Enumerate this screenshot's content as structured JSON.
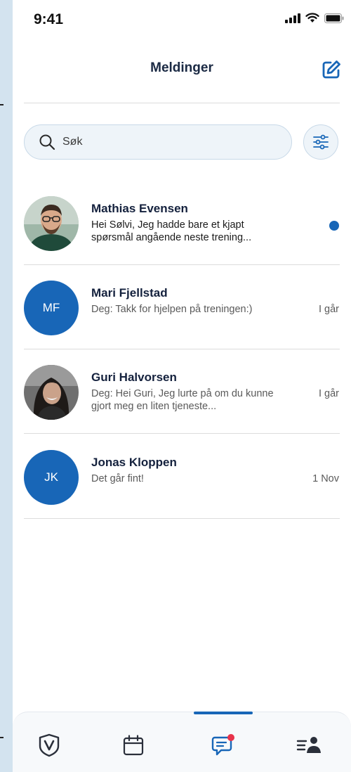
{
  "status_bar": {
    "time": "9:41"
  },
  "header": {
    "title": "Meldinger",
    "compose_icon": "compose-icon"
  },
  "search": {
    "placeholder": "Søk",
    "filter_icon": "filter-sliders-icon"
  },
  "conversations": [
    {
      "name": "Mathias Evensen",
      "preview": "Hei Sølvi, Jeg hadde bare et kjapt spørsmål angående neste trening...",
      "time": "",
      "unread": true,
      "avatar": "photo"
    },
    {
      "name": "Mari Fjellstad",
      "preview": "Deg: Takk for hjelpen på treningen:)",
      "time": "I går",
      "unread": false,
      "initials": "MF"
    },
    {
      "name": "Guri Halvorsen",
      "preview": "Deg: Hei Guri, Jeg lurte på om du kunne gjort meg en liten tjeneste...",
      "time": "I går",
      "unread": false,
      "avatar": "photo"
    },
    {
      "name": "Jonas Kloppen",
      "preview": "Det går fint!",
      "time": "1 Nov",
      "unread": false,
      "initials": "JK"
    }
  ],
  "tab_bar": {
    "tabs": [
      "home-v-icon",
      "calendar-icon",
      "messages-icon",
      "members-icon"
    ],
    "active_tab": "messages-icon",
    "notification_badge": true
  },
  "colors": {
    "accent": "#1866b7",
    "badge": "#e8334a",
    "background": "#d3e3ef"
  }
}
